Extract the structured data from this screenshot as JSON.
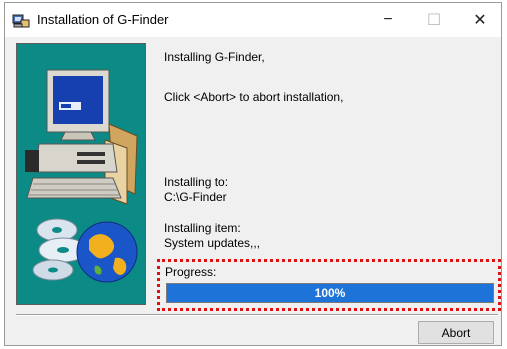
{
  "window": {
    "title": "Installation of G-Finder",
    "minimize_glyph": "−",
    "maximize_glyph": "☐",
    "close_glyph": "✕"
  },
  "content": {
    "heading": "Installing G-Finder,",
    "instruction": "Click <Abort> to abort installation,",
    "install_to_label": "Installing to:",
    "install_to_path": "C:\\G-Finder",
    "item_label": "Installing item:",
    "item_value": "System updates,,,"
  },
  "progress": {
    "label": "Progress:",
    "value_text": "100%",
    "fraction": 1.0
  },
  "buttons": {
    "abort_label": "Abort"
  },
  "colors": {
    "graphic_background": "#0b8a86",
    "progress_fill": "#1e73d8",
    "highlight_border": "#e01010"
  },
  "icons": [
    "installer-icon",
    "computer-icon",
    "cd-icon",
    "globe-icon"
  ]
}
